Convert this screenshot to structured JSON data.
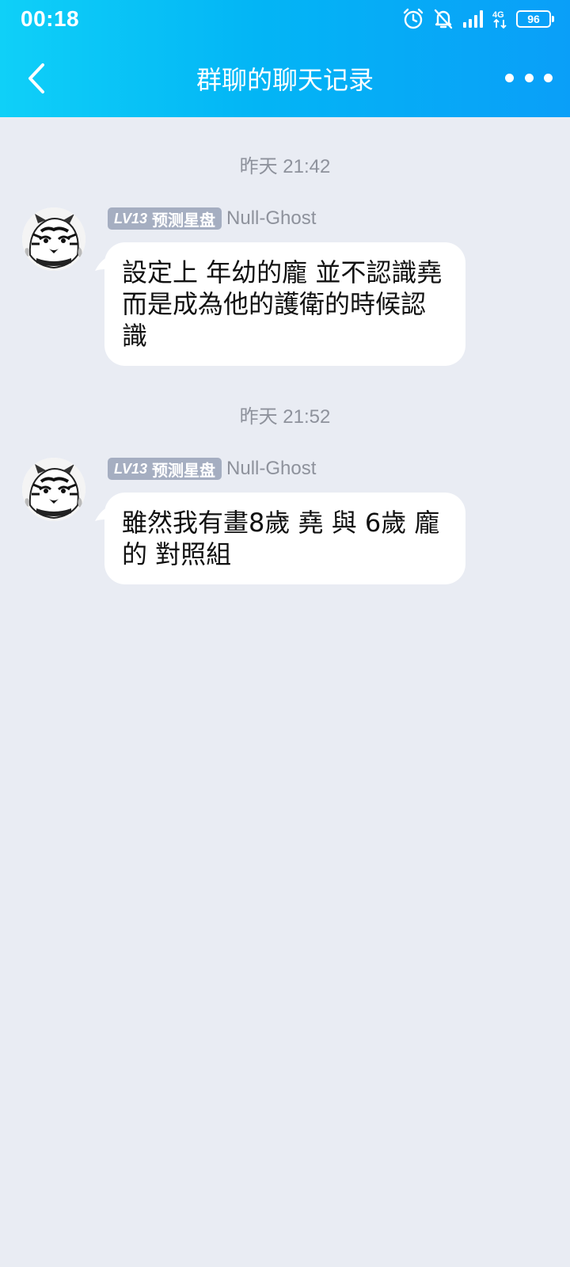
{
  "status_bar": {
    "time": "00:18",
    "battery": "96",
    "network": "4G",
    "icons": [
      "alarm-icon",
      "bell-off-icon",
      "signal-icon",
      "network-4g-icon",
      "battery-icon"
    ]
  },
  "header": {
    "title": "群聊的聊天记录",
    "back_icon": "back-arrow-icon",
    "more_icon": "more-icon"
  },
  "messages": [
    {
      "timestamp": "昨天 21:42",
      "level": "LV13",
      "title": "预测星盘",
      "sender": "Null-Ghost",
      "text": "設定上 年幼的龐 並不認識堯 而是成為他的護衛的時候認識"
    },
    {
      "timestamp": "昨天 21:52",
      "level": "LV13",
      "title": "预测星盘",
      "sender": "Null-Ghost",
      "text": "雖然我有畫8歲 堯 與 6歲 龐的 對照組"
    }
  ],
  "colors": {
    "header_gradient_start": "#0fd0f8",
    "header_gradient_end": "#0a9ff8",
    "background": "#e9ecf3",
    "badge": "#a5aec1",
    "bubble": "#ffffff"
  }
}
